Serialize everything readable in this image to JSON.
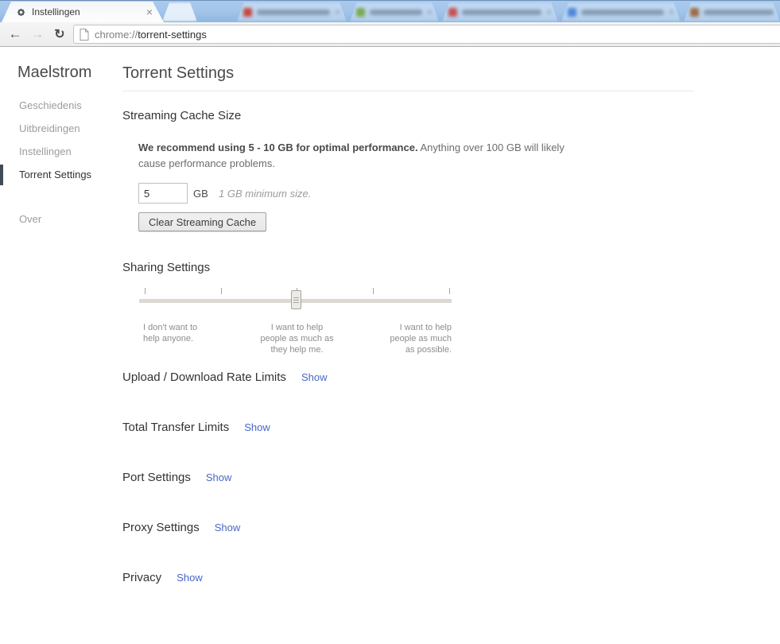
{
  "colors": {
    "link_blue": "#4767c8",
    "tabbar_blue": "#a3c5ea",
    "sidebar_indicator": "#414b56"
  },
  "browser": {
    "tab_title": "Instellingen",
    "url_scheme": "chrome://",
    "url_path": "torrent-settings",
    "icons": {
      "close": "×",
      "back": "←",
      "forward": "→",
      "reload": "↻"
    },
    "background_tabs": [
      {
        "favicon_color": "#c4483e"
      },
      {
        "favicon_color": "#79a84f"
      },
      {
        "favicon_color": "#c4504f"
      },
      {
        "favicon_color": "#4f86d5"
      },
      {
        "favicon_color": "#9c6a42"
      }
    ]
  },
  "sidebar": {
    "title": "Maelstrom",
    "items": [
      {
        "label": "Geschiedenis",
        "active": false
      },
      {
        "label": "Uitbreidingen",
        "active": false
      },
      {
        "label": "Instellingen",
        "active": false
      },
      {
        "label": "Torrent Settings",
        "active": true
      },
      {
        "label": "Over",
        "active": false
      }
    ]
  },
  "main": {
    "title": "Torrent Settings",
    "streaming_cache": {
      "heading": "Streaming Cache Size",
      "note_bold": "We recommend using 5 - 10 GB for optimal performance.",
      "note_rest": " Anything over 100 GB will likely cause performance problems.",
      "value": "5",
      "unit": "GB",
      "min_note": "1 GB minimum size.",
      "clear_button": "Clear Streaming Cache"
    },
    "sharing": {
      "heading": "Sharing Settings",
      "slider_labels": [
        "I don't want to\nhelp anyone.",
        "I want to help\npeople as much as\nthey help me.",
        "I want to help\npeople as much\nas possible."
      ]
    },
    "sections": [
      {
        "heading": "Upload / Download Rate Limits",
        "link": "Show"
      },
      {
        "heading": "Total Transfer Limits",
        "link": "Show"
      },
      {
        "heading": "Port Settings",
        "link": "Show"
      },
      {
        "heading": "Proxy Settings",
        "link": "Show"
      },
      {
        "heading": "Privacy",
        "link": "Show"
      }
    ]
  }
}
